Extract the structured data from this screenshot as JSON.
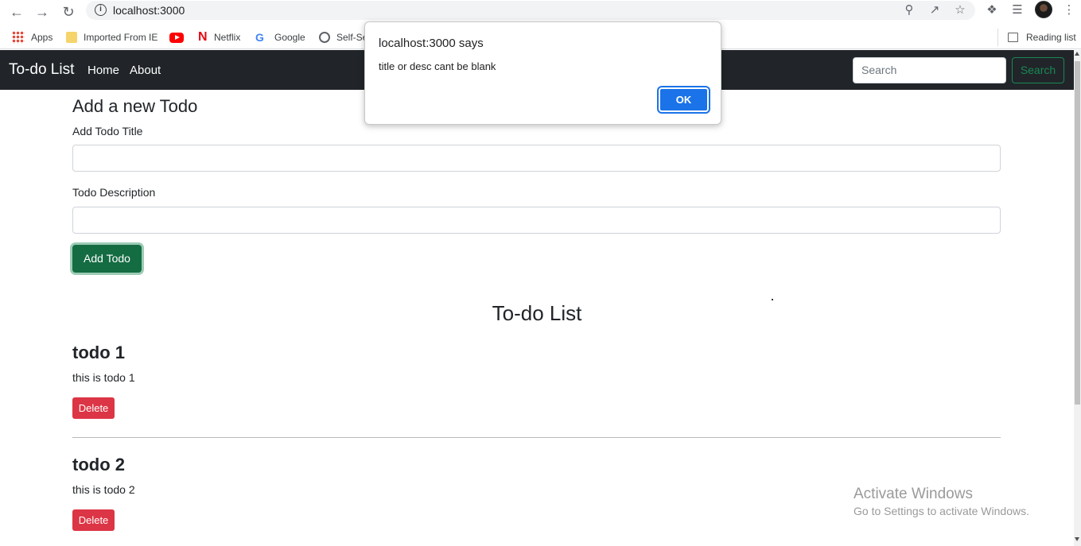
{
  "browser": {
    "url": "localhost:3000",
    "bookmarks": [
      {
        "label": "Apps",
        "icon": "apps-grid-icon"
      },
      {
        "label": "Imported From IE",
        "icon": "folder-icon"
      },
      {
        "label": "",
        "icon": "youtube-icon"
      },
      {
        "label": "Netflix",
        "icon": "netflix-icon"
      },
      {
        "label": "Google",
        "icon": "google-icon"
      },
      {
        "label": "Self-Se",
        "icon": "globe-icon"
      }
    ],
    "reading_list": "Reading list"
  },
  "navbar": {
    "brand": "To-do List",
    "links": [
      "Home",
      "About"
    ],
    "search_placeholder": "Search",
    "search_button": "Search"
  },
  "form": {
    "heading": "Add a new Todo",
    "title_label": "Add Todo Title",
    "title_value": "",
    "desc_label": "Todo Description",
    "desc_value": "",
    "submit_label": "Add Todo"
  },
  "list": {
    "heading": "To-do List",
    "todos": [
      {
        "title": "todo 1",
        "desc": "this is todo 1",
        "delete_label": "Delete"
      },
      {
        "title": "todo 2",
        "desc": "this is todo 2",
        "delete_label": "Delete"
      }
    ]
  },
  "dialog": {
    "title": "localhost:3000 says",
    "message": "title or desc cant be blank",
    "ok_label": "OK"
  },
  "watermark": {
    "line1": "Activate Windows",
    "line2": "Go to Settings to activate Windows."
  },
  "colors": {
    "navbar_bg": "#212529",
    "success": "#198754",
    "danger": "#dc3545",
    "dialog_ok": "#1a73e8"
  }
}
